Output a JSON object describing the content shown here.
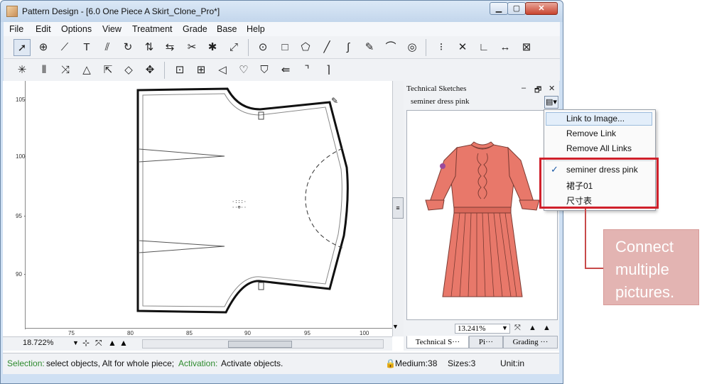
{
  "window": {
    "title": "Pattern Design - [6.0 One Piece A Skirt_Clone_Pro*]",
    "controls": {
      "minimize": "▁",
      "maximize": "▢",
      "close": "✕"
    }
  },
  "menu": [
    "File",
    "Edit",
    "Options",
    "View",
    "Treatment",
    "Grade",
    "Base",
    "Help"
  ],
  "toolbar1_icons": [
    "select-arrow-icon",
    "zoom-icon",
    "measure-icon",
    "text-icon",
    "cut-icon",
    "rotate-icon",
    "flip-icon",
    "mirror-icon",
    "split-icon",
    "dart-icon",
    "fold-icon",
    "circle-icon",
    "rectangle-icon",
    "polygon-icon",
    "line-icon",
    "curve-icon",
    "edit-icon",
    "seam-icon",
    "spiral-icon",
    "notch-icon",
    "point-icon",
    "axis-icon",
    "grainline-icon",
    "corner-icon"
  ],
  "toolbar2_icons": [
    "burst-icon",
    "pleat-icon",
    "slash-icon",
    "fan-icon",
    "anchor-icon",
    "gem-icon",
    "move-icon",
    "box-icon",
    "stretch-icon",
    "arrow-left-icon",
    "heart-icon",
    "shield-icon",
    "arrow-double-icon",
    "corner-right-icon",
    "corner-down-icon"
  ],
  "ruler": {
    "vertical_labels": [
      "105",
      "100",
      "95",
      "90"
    ],
    "horizontal_labels": [
      "75",
      "80",
      "85",
      "90",
      "95",
      "100"
    ]
  },
  "canvas": {
    "zoom": "18.722%"
  },
  "panel": {
    "title": "Technical Sketches",
    "pin": "‒",
    "restore": "🗗",
    "close": "✕",
    "sketch_name": "seminer dress pink",
    "zoom": "13.241%",
    "tabs": [
      "Technical S···",
      "Pi···",
      "Grading ···"
    ]
  },
  "popup_menu": {
    "items": [
      "Link to Image...",
      "Remove Link",
      "Remove All Links"
    ],
    "links": [
      "seminer dress pink",
      "裙子01",
      "尺寸表"
    ],
    "checked_index": 0
  },
  "status": {
    "selection_label": "Selection:",
    "selection_text": "select objects, Alt for whole piece;",
    "activation_label": "Activation:",
    "activation_text": "Activate objects.",
    "medium": "Medium:38",
    "sizes": "Sizes:3",
    "unit": "Unit:in"
  },
  "callout": {
    "text": "Connect\nmultiple\npictures."
  },
  "colors": {
    "dress": "#e8786a",
    "callout": "#e3b4b2",
    "highlight": "#d0202b"
  }
}
